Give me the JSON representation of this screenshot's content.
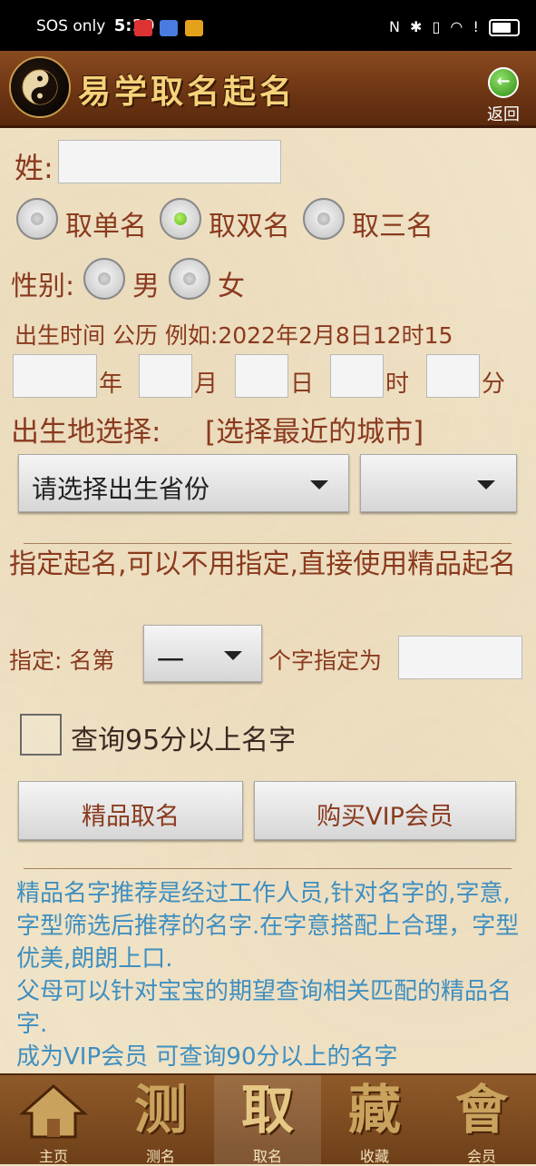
{
  "status_bar": {
    "carrier": "SOS only",
    "time": "5:19"
  },
  "header": {
    "title": "易学取名起名",
    "back_label": "返回"
  },
  "form": {
    "surname_label": "姓:",
    "surname_value": "",
    "name_type_options": [
      "取单名",
      "取双名",
      "取三名"
    ],
    "name_type_selected": "取双名",
    "gender_label": "性别:",
    "gender_options": [
      "男",
      "女"
    ],
    "birth_time_hint": "出生时间 公历 例如:2022年2月8日12时15",
    "date_units": [
      "年",
      "月",
      "日",
      "时",
      "分"
    ],
    "birthplace_label": "出生地选择:",
    "birthplace_link": "[选择最近的城市]",
    "province_select": "请选择出生省份",
    "city_select": "",
    "designate_intro": "指定起名,可以不用指定,直接使用精品起名",
    "designate_prefix": "指定: 名第",
    "designate_position": "一",
    "designate_suffix": "个字指定为",
    "designate_value": "",
    "checkbox_label": "查询95分以上名字",
    "checkbox_checked": false,
    "button_premium": "精品取名",
    "button_vip": "购买VIP会员",
    "info_text_1": "精品名字推荐是经过工作人员,针对名字的,字意,字型筛选后推荐的名字.在字意搭配上合理，字型优美,朗朗上口.",
    "info_text_2": "父母可以针对宝宝的期望查询相关匹配的精品名字.",
    "info_text_3": "成为VIP会员 可查询90分以上的名字"
  },
  "bottom_nav": [
    {
      "glyph": "",
      "label": "主页",
      "icon": "home-icon"
    },
    {
      "glyph": "测",
      "label": "测名"
    },
    {
      "glyph": "取",
      "label": "取名",
      "active": true
    },
    {
      "glyph": "藏",
      "label": "收藏"
    },
    {
      "glyph": "會",
      "label": "会员"
    }
  ],
  "colors": {
    "label_brown": "#8a3a1e",
    "info_blue": "#3f8fc0",
    "header_brown": "#6b3413"
  }
}
